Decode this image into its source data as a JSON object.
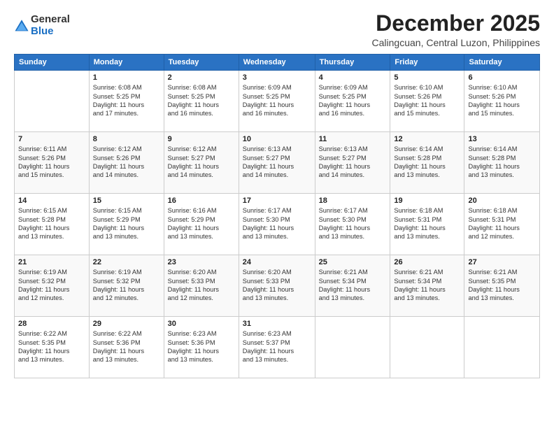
{
  "logo": {
    "general": "General",
    "blue": "Blue"
  },
  "title": "December 2025",
  "location": "Calingcuan, Central Luzon, Philippines",
  "days_header": [
    "Sunday",
    "Monday",
    "Tuesday",
    "Wednesday",
    "Thursday",
    "Friday",
    "Saturday"
  ],
  "weeks": [
    [
      {
        "day": "",
        "info": ""
      },
      {
        "day": "1",
        "info": "Sunrise: 6:08 AM\nSunset: 5:25 PM\nDaylight: 11 hours\nand 17 minutes."
      },
      {
        "day": "2",
        "info": "Sunrise: 6:08 AM\nSunset: 5:25 PM\nDaylight: 11 hours\nand 16 minutes."
      },
      {
        "day": "3",
        "info": "Sunrise: 6:09 AM\nSunset: 5:25 PM\nDaylight: 11 hours\nand 16 minutes."
      },
      {
        "day": "4",
        "info": "Sunrise: 6:09 AM\nSunset: 5:25 PM\nDaylight: 11 hours\nand 16 minutes."
      },
      {
        "day": "5",
        "info": "Sunrise: 6:10 AM\nSunset: 5:26 PM\nDaylight: 11 hours\nand 15 minutes."
      },
      {
        "day": "6",
        "info": "Sunrise: 6:10 AM\nSunset: 5:26 PM\nDaylight: 11 hours\nand 15 minutes."
      }
    ],
    [
      {
        "day": "7",
        "info": "Sunrise: 6:11 AM\nSunset: 5:26 PM\nDaylight: 11 hours\nand 15 minutes."
      },
      {
        "day": "8",
        "info": "Sunrise: 6:12 AM\nSunset: 5:26 PM\nDaylight: 11 hours\nand 14 minutes."
      },
      {
        "day": "9",
        "info": "Sunrise: 6:12 AM\nSunset: 5:27 PM\nDaylight: 11 hours\nand 14 minutes."
      },
      {
        "day": "10",
        "info": "Sunrise: 6:13 AM\nSunset: 5:27 PM\nDaylight: 11 hours\nand 14 minutes."
      },
      {
        "day": "11",
        "info": "Sunrise: 6:13 AM\nSunset: 5:27 PM\nDaylight: 11 hours\nand 14 minutes."
      },
      {
        "day": "12",
        "info": "Sunrise: 6:14 AM\nSunset: 5:28 PM\nDaylight: 11 hours\nand 13 minutes."
      },
      {
        "day": "13",
        "info": "Sunrise: 6:14 AM\nSunset: 5:28 PM\nDaylight: 11 hours\nand 13 minutes."
      }
    ],
    [
      {
        "day": "14",
        "info": "Sunrise: 6:15 AM\nSunset: 5:28 PM\nDaylight: 11 hours\nand 13 minutes."
      },
      {
        "day": "15",
        "info": "Sunrise: 6:15 AM\nSunset: 5:29 PM\nDaylight: 11 hours\nand 13 minutes."
      },
      {
        "day": "16",
        "info": "Sunrise: 6:16 AM\nSunset: 5:29 PM\nDaylight: 11 hours\nand 13 minutes."
      },
      {
        "day": "17",
        "info": "Sunrise: 6:17 AM\nSunset: 5:30 PM\nDaylight: 11 hours\nand 13 minutes."
      },
      {
        "day": "18",
        "info": "Sunrise: 6:17 AM\nSunset: 5:30 PM\nDaylight: 11 hours\nand 13 minutes."
      },
      {
        "day": "19",
        "info": "Sunrise: 6:18 AM\nSunset: 5:31 PM\nDaylight: 11 hours\nand 13 minutes."
      },
      {
        "day": "20",
        "info": "Sunrise: 6:18 AM\nSunset: 5:31 PM\nDaylight: 11 hours\nand 12 minutes."
      }
    ],
    [
      {
        "day": "21",
        "info": "Sunrise: 6:19 AM\nSunset: 5:32 PM\nDaylight: 11 hours\nand 12 minutes."
      },
      {
        "day": "22",
        "info": "Sunrise: 6:19 AM\nSunset: 5:32 PM\nDaylight: 11 hours\nand 12 minutes."
      },
      {
        "day": "23",
        "info": "Sunrise: 6:20 AM\nSunset: 5:33 PM\nDaylight: 11 hours\nand 12 minutes."
      },
      {
        "day": "24",
        "info": "Sunrise: 6:20 AM\nSunset: 5:33 PM\nDaylight: 11 hours\nand 13 minutes."
      },
      {
        "day": "25",
        "info": "Sunrise: 6:21 AM\nSunset: 5:34 PM\nDaylight: 11 hours\nand 13 minutes."
      },
      {
        "day": "26",
        "info": "Sunrise: 6:21 AM\nSunset: 5:34 PM\nDaylight: 11 hours\nand 13 minutes."
      },
      {
        "day": "27",
        "info": "Sunrise: 6:21 AM\nSunset: 5:35 PM\nDaylight: 11 hours\nand 13 minutes."
      }
    ],
    [
      {
        "day": "28",
        "info": "Sunrise: 6:22 AM\nSunset: 5:35 PM\nDaylight: 11 hours\nand 13 minutes."
      },
      {
        "day": "29",
        "info": "Sunrise: 6:22 AM\nSunset: 5:36 PM\nDaylight: 11 hours\nand 13 minutes."
      },
      {
        "day": "30",
        "info": "Sunrise: 6:23 AM\nSunset: 5:36 PM\nDaylight: 11 hours\nand 13 minutes."
      },
      {
        "day": "31",
        "info": "Sunrise: 6:23 AM\nSunset: 5:37 PM\nDaylight: 11 hours\nand 13 minutes."
      },
      {
        "day": "",
        "info": ""
      },
      {
        "day": "",
        "info": ""
      },
      {
        "day": "",
        "info": ""
      }
    ]
  ]
}
